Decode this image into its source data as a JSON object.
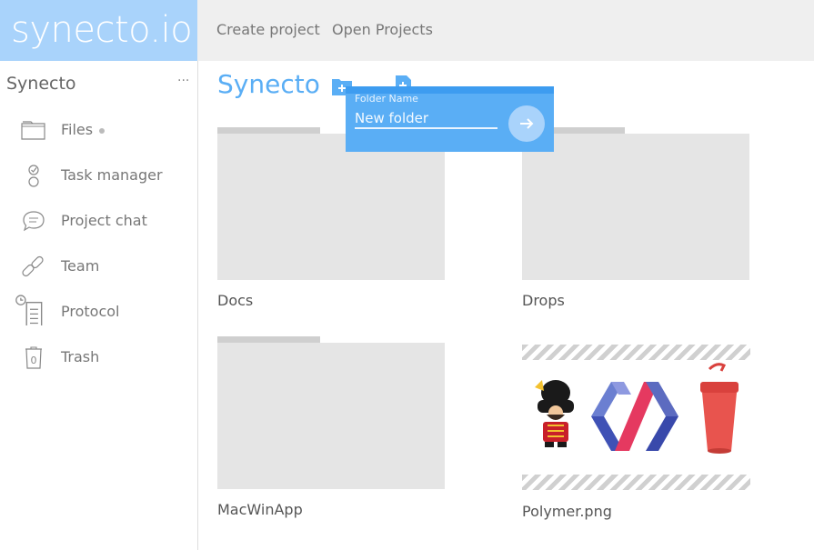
{
  "app": {
    "logo": "synecto.io"
  },
  "topnav": {
    "create_project": "Create project",
    "open_projects": "Open Projects"
  },
  "sidebar": {
    "title": "Synecto",
    "more": "···",
    "items": [
      {
        "label": "Files",
        "icon": "folder-icon"
      },
      {
        "label": "Task manager",
        "icon": "checklist-icon"
      },
      {
        "label": "Project chat",
        "icon": "chat-bubble-icon"
      },
      {
        "label": "Team",
        "icon": "link-icon"
      },
      {
        "label": "Protocol",
        "icon": "document-icon"
      },
      {
        "label": "Trash",
        "icon": "trash-icon",
        "count": "0"
      }
    ]
  },
  "main": {
    "title": "Synecto",
    "toolbar": {
      "new_folder_icon": "add-folder-icon",
      "new_file_icon": "add-file-icon"
    },
    "tiles": [
      {
        "label": "Docs",
        "type": "folder"
      },
      {
        "label": "Drops",
        "type": "folder"
      },
      {
        "label": "MacWinApp",
        "type": "folder"
      },
      {
        "label": "Polymer.png",
        "type": "image"
      }
    ]
  },
  "popup": {
    "label": "Folder Name",
    "placeholder": "New folder",
    "accent": "#5aaef5"
  },
  "colors": {
    "accent": "#5aaef5",
    "logo_bg": "#a9d3fb",
    "topbar_bg": "#efefef"
  }
}
